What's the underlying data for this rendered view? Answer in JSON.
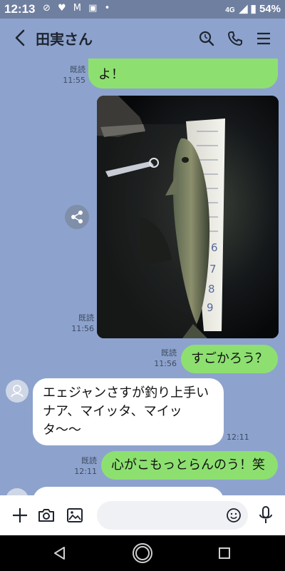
{
  "status": {
    "time": "12:13",
    "icons": "⊘ ♥ M ▣ •",
    "network": "4G",
    "battery": "54%"
  },
  "header": {
    "contact_name": "田実さん"
  },
  "messages": [
    {
      "type": "out",
      "text": "よ！",
      "read_label": "既読",
      "time": "11:55"
    },
    {
      "type": "out-image",
      "read_label": "既読",
      "time": "11:56"
    },
    {
      "type": "out",
      "text": "すごかろう？",
      "read_label": "既読",
      "time": "11:56"
    },
    {
      "type": "in",
      "text": "エェジャンさすが釣り上手いナア、マイッタ、マイッタ〜〜",
      "time": "12:11"
    },
    {
      "type": "out",
      "text": "心がこもっとらんのう！笑",
      "read_label": "既読",
      "time": "12:11"
    }
  ],
  "composer": {
    "placeholder": ""
  },
  "colors": {
    "background": "#8da3cd",
    "outgoing_bubble": "#8de070",
    "incoming_bubble": "#ffffff"
  }
}
